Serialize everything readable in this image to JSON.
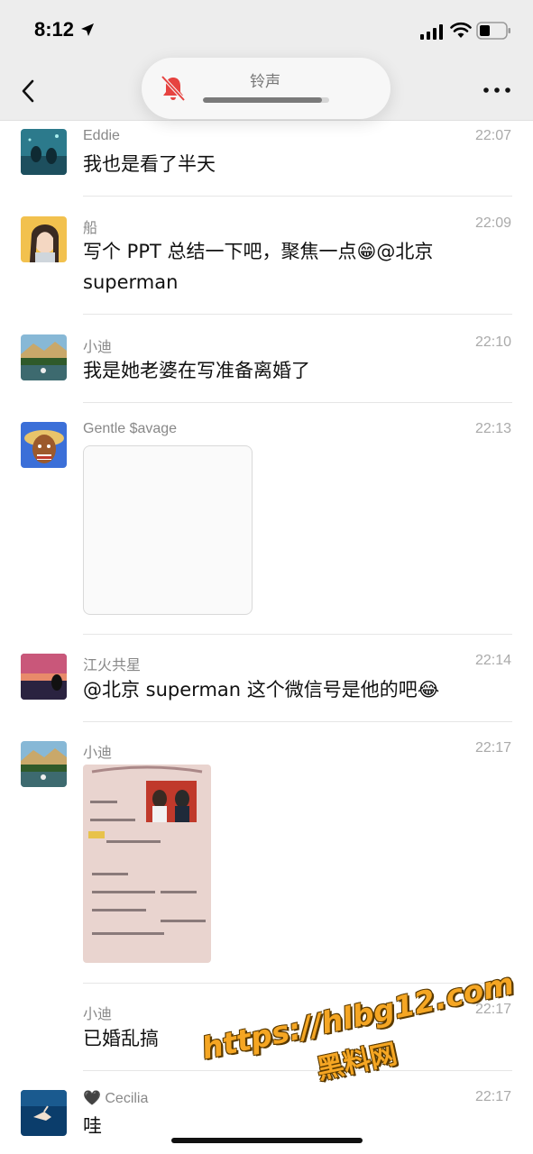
{
  "status_bar": {
    "time": "8:12"
  },
  "ringer": {
    "label": "铃声",
    "level": 0.94
  },
  "messages": [
    {
      "sender": "Eddie",
      "time": "22:07",
      "text": "我也是看了半天"
    },
    {
      "sender": "船",
      "time": "22:09",
      "text_line1": "写个 PPT 总结一下吧，聚焦一点😁@北京",
      "text_line2": "superman"
    },
    {
      "sender": "小迪",
      "time": "22:10",
      "text": "我是她老婆在写准备离婚了"
    },
    {
      "sender": "Gentle $avage",
      "time": "22:13"
    },
    {
      "sender": "江火共星",
      "time": "22:14",
      "text": "@北京 superman 这个微信号是他的吧😂"
    },
    {
      "sender": "小迪",
      "time": "22:17"
    },
    {
      "sender": "小迪",
      "time": "22:17",
      "text": "已婚乱搞"
    },
    {
      "sender": "🖤 Cecilia",
      "time": "22:17",
      "text": "哇"
    }
  ],
  "watermark": {
    "url": "https://hlbg12.com",
    "sub": "黑料网"
  },
  "colors": {
    "nav_bg": "#ededed",
    "muted_bell": "#e64340",
    "watermark": "#f5a623"
  }
}
